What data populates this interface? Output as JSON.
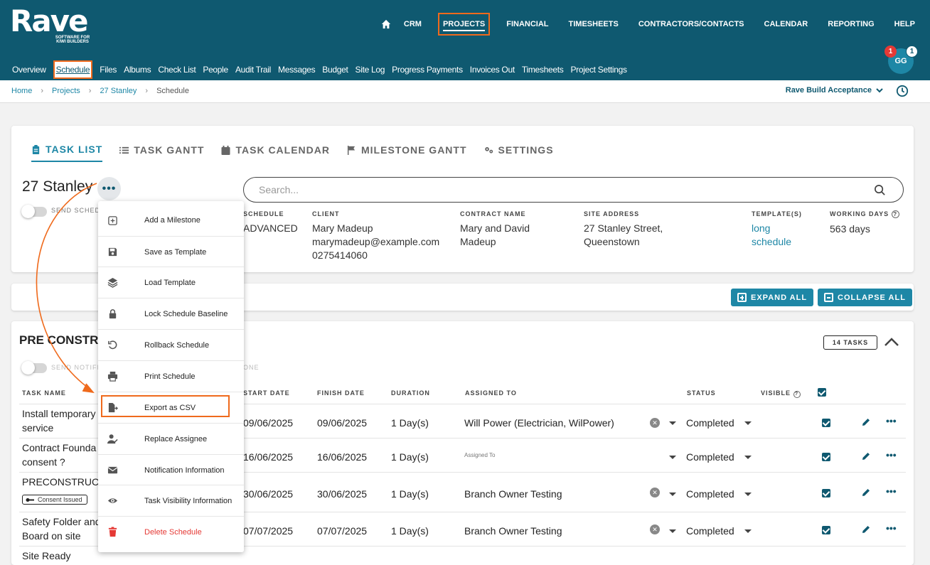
{
  "app": {
    "logo": "Rave",
    "tagline": "SOFTWARE FOR KIWI BUILDERS"
  },
  "main_nav": [
    "CRM",
    "PROJECTS",
    "FINANCIAL",
    "TIMESHEETS",
    "CONTRACTORS/CONTACTS",
    "CALENDAR",
    "REPORTING",
    "HELP"
  ],
  "main_nav_active": "PROJECTS",
  "user": {
    "initials": "GG",
    "notifications": "1",
    "messages": "1"
  },
  "sub_nav": [
    "Overview",
    "Schedule",
    "Files",
    "Albums",
    "Check List",
    "People",
    "Audit Trail",
    "Messages",
    "Budget",
    "Site Log",
    "Progress Payments",
    "Invoices Out",
    "Timesheets",
    "Project Settings"
  ],
  "sub_nav_active": "Schedule",
  "breadcrumb": {
    "home": "Home",
    "projects": "Projects",
    "project": "27 Stanley",
    "current": "Schedule"
  },
  "company_select": "Rave Build Acceptance",
  "tabs": [
    "TASK LIST",
    "TASK GANTT",
    "TASK CALENDAR",
    "MILESTONE GANTT",
    "SETTINGS"
  ],
  "project": {
    "title": "27 Stanley",
    "send_toggle_label": "SEND SCHED",
    "search_placeholder": "Search...",
    "info": {
      "schedule_label": "SCHEDULE",
      "schedule_value": "ADVANCED",
      "client_label": "CLIENT",
      "client_name": "Mary Madeup",
      "client_email": "marymadeup@example.com",
      "client_phone": "0275414060",
      "contract_label": "CONTRACT NAME",
      "contract_line1": "Mary and David",
      "contract_line2": "Madeup",
      "site_label": "SITE ADDRESS",
      "site_line1": "27 Stanley Street,",
      "site_line2": "Queenstown",
      "template_label": "TEMPLATE(S)",
      "template_line1": "long",
      "template_line2": "schedule",
      "working_label": "WORKING DAYS",
      "working_value": "563 days"
    }
  },
  "actions": {
    "expand": "EXPAND ALL",
    "collapse": "COLLAPSE ALL"
  },
  "section": {
    "title": "PRE CONSTRU",
    "tasks_count": "14 TASKS",
    "notify_label": "SEND NOTIFI",
    "notify_tail": "ONE",
    "columns": {
      "task": "TASK NAME",
      "start": "START DATE",
      "finish": "FINISH DATE",
      "duration": "DURATION",
      "assigned": "ASSIGNED TO",
      "status": "STATUS",
      "visible": "VISIBLE"
    },
    "rows": [
      {
        "name1": "Install temporary",
        "name2": "service",
        "start": "09/06/2025",
        "finish": "09/06/2025",
        "duration": "1 Day(s)",
        "assigned": "Will Power (Electrician, WilPower)",
        "status": "Completed"
      },
      {
        "name1": "Contract Founda",
        "name2": "consent ?",
        "start": "16/06/2025",
        "finish": "16/06/2025",
        "duration": "1 Day(s)",
        "assigned": "Assigned To",
        "status": "Completed"
      },
      {
        "name1": "PRECONSTRUCT",
        "tag": "Consent Issued",
        "start": "30/06/2025",
        "finish": "30/06/2025",
        "duration": "1 Day(s)",
        "assigned": "Branch Owner Testing",
        "status": "Completed"
      },
      {
        "name1": "Safety Folder and",
        "name2": "Board on site",
        "start": "07/07/2025",
        "finish": "07/07/2025",
        "duration": "1 Day(s)",
        "assigned": "Branch Owner Testing",
        "status": "Completed"
      },
      {
        "name1": "Site Ready"
      }
    ]
  },
  "menu": [
    {
      "label": "Add a Milestone",
      "icon": "plus-square-icon"
    },
    {
      "label": "Save as Template",
      "icon": "save-icon"
    },
    {
      "label": "Load Template",
      "icon": "layers-icon"
    },
    {
      "label": "Lock Schedule Baseline",
      "icon": "lock-icon"
    },
    {
      "label": "Rollback Schedule",
      "icon": "undo-icon"
    },
    {
      "label": "Print Schedule",
      "icon": "print-icon"
    },
    {
      "label": "Export as CSV",
      "icon": "file-export-icon"
    },
    {
      "label": "Replace Assignee",
      "icon": "user-edit-icon"
    },
    {
      "label": "Notification Information",
      "icon": "envelope-icon"
    },
    {
      "label": "Task Visibility Information",
      "icon": "eye-icon"
    },
    {
      "label": "Delete Schedule",
      "icon": "trash-icon"
    }
  ],
  "colors": {
    "header": "#0f5970",
    "accent": "#1e87a6",
    "highlight": "#ef6a1c",
    "danger": "#e53935"
  }
}
